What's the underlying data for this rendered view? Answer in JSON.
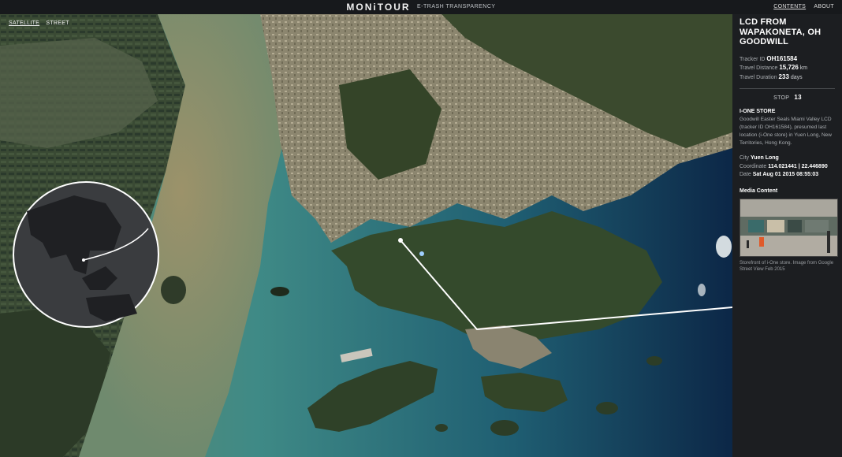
{
  "header": {
    "logo": "MONiTOUR",
    "tagline": "E-TRASH TRANSPARENCY",
    "nav": [
      "CONTENTS",
      "ABOUT"
    ]
  },
  "map": {
    "toggle": [
      "SATELLITE",
      "STREET"
    ],
    "selected": "SATELLITE",
    "colors": {
      "water": "#2f7a84",
      "deep_water": "#0e2a4a",
      "estuary": "#8f8760",
      "land": "#3f4a2c",
      "urban": "#9a9078",
      "route": "#ffffff"
    }
  },
  "panel": {
    "title": "LCD FROM WAPAKONETA, OH GOODWILL",
    "tracker_label": "Tracker ID",
    "tracker_value": "OH161584",
    "distance_label": "Travel Distance",
    "distance_value": "15,726",
    "distance_unit": "km",
    "duration_label": "Travel Duration",
    "duration_value": "233",
    "duration_unit": "days",
    "stop_label": "STOP",
    "stop_value": "13",
    "store_name": "I-ONE STORE",
    "description": "Goodwill Easter Seals Miami Valley LCD (tracker ID OH161584), presumed last location (i-One store) in Yuen Long, New Territories, Hong Kong.",
    "city_label": "City",
    "city_value": "Yuen Long",
    "coord_label": "Coordinate",
    "coord_value": "114.021441 | 22.446890",
    "date_label": "Date",
    "date_value": "Sat Aug 01 2015 08:55:03",
    "media_label": "Media Content",
    "photo_caption": "Storefront of i-One store. Image from Google Street View Feb 2015"
  }
}
